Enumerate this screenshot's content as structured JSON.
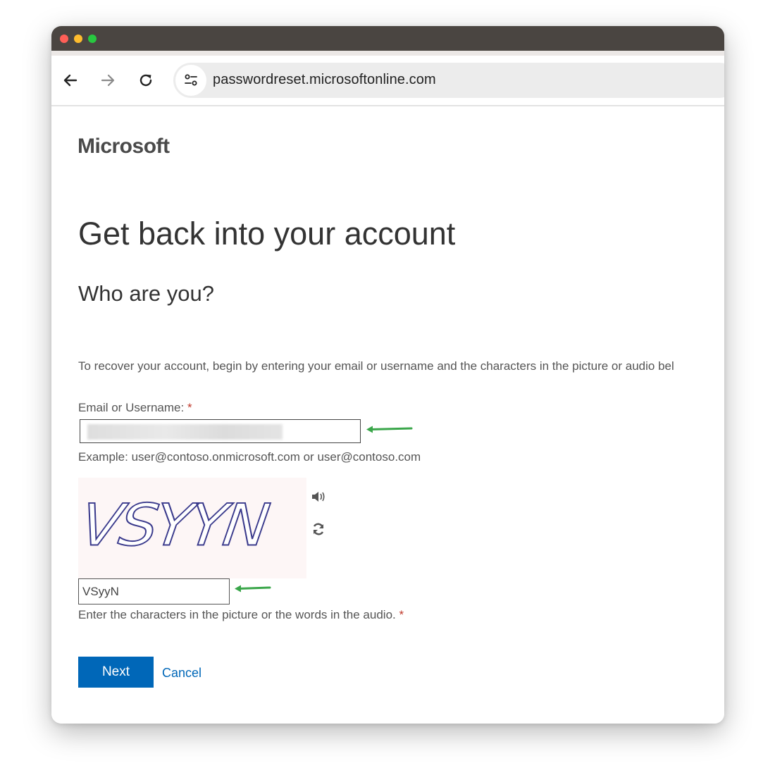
{
  "browser": {
    "url": "passwordreset.microsoftonline.com",
    "icons": {
      "back": "arrow-left-icon",
      "forward": "arrow-right-icon",
      "reload": "reload-icon",
      "site_info": "site-settings-icon"
    }
  },
  "page": {
    "logo": "Microsoft",
    "heading": "Get back into your account",
    "subheading": "Who are you?",
    "instructions": "To recover your account, begin by entering your email or username and the characters in the picture or audio bel",
    "email": {
      "label": "Email or Username:",
      "required_mark": "*",
      "value": "",
      "example": "Example: user@contoso.onmicrosoft.com or user@contoso.com"
    },
    "captcha": {
      "image_text": "VSYYN",
      "audio_icon": "speaker-icon",
      "refresh_icon": "refresh-icon",
      "input_value": "VSyyN",
      "hint": "Enter the characters in the picture or the words in the audio.",
      "required_mark": "*"
    },
    "buttons": {
      "next": "Next",
      "cancel": "Cancel"
    }
  },
  "colors": {
    "accent": "#0067b8",
    "annotation_arrow": "#3aa64a",
    "required": "#c0392b",
    "titlebar": "#4a4541"
  }
}
